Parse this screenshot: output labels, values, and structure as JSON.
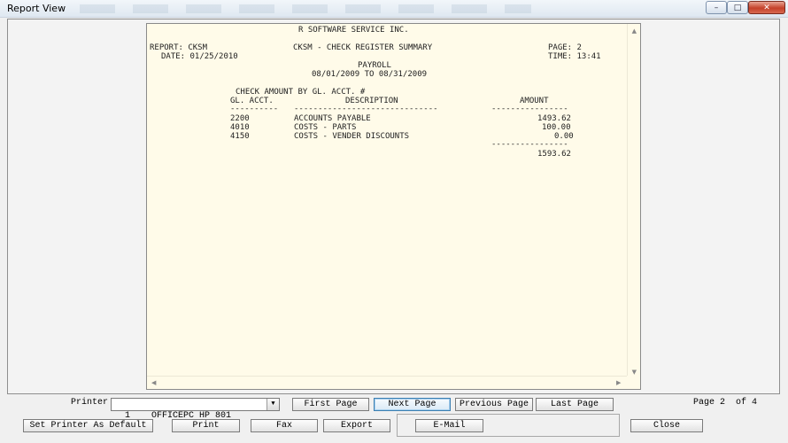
{
  "window": {
    "title": "Report View",
    "minimize_glyph": "–",
    "maximize_glyph": "□",
    "close_glyph": "✕"
  },
  "report": {
    "company": "R SOFTWARE SERVICE INC.",
    "report_label": "REPORT: CKSM",
    "report_title": "CKSM - CHECK REGISTER SUMMARY",
    "page_label": "PAGE: 2",
    "date_label": "DATE: 01/25/2010",
    "time_label": "TIME: 13:41",
    "section": "PAYROLL",
    "period": "08/01/2009 TO 08/31/2009",
    "subheading": "CHECK AMOUNT BY GL. ACCT. #",
    "col_acct": "GL. ACCT.",
    "col_desc": "DESCRIPTION",
    "col_amount": "AMOUNT",
    "rule_acct": "----------",
    "rule_desc": "------------------------------",
    "rule_amount": "----------------",
    "rows": [
      {
        "acct": "2200",
        "desc": "ACCOUNTS PAYABLE",
        "amount": "1493.62"
      },
      {
        "acct": "4010",
        "desc": "COSTS - PARTS",
        "amount": "100.00"
      },
      {
        "acct": "4150",
        "desc": "COSTS - VENDER DISCOUNTS",
        "amount": "0.00"
      }
    ],
    "total_rule": "----------------",
    "total": "1593.62"
  },
  "controls": {
    "printer_label": "Printer",
    "printer_value": "1    OFFICEPC HP 801",
    "dropdown_glyph": "▼",
    "first_page": "First Page",
    "next_page": "Next Page",
    "previous_page": "Previous Page",
    "last_page": "Last Page",
    "page_status": "Page 2  of 4",
    "set_default": "Set Printer As Default",
    "print": "Print",
    "fax": "Fax",
    "export": "Export",
    "email": "E-Mail",
    "close": "Close"
  }
}
